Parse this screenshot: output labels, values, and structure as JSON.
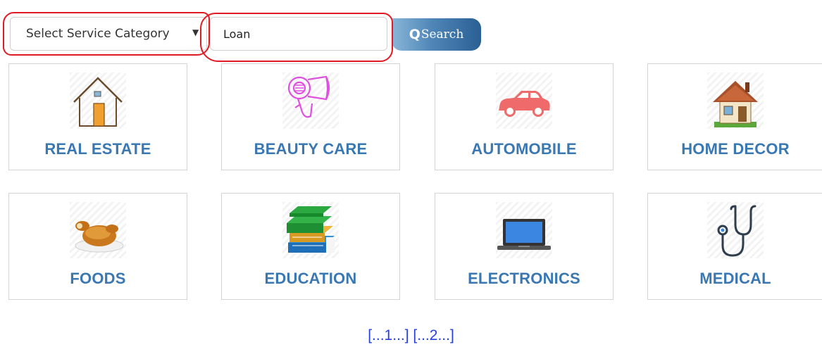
{
  "search": {
    "category_select": {
      "value": "Select Service Category"
    },
    "query_input": {
      "value": "Loan"
    },
    "button_label": "Search"
  },
  "categories": [
    {
      "label": "REAL ESTATE",
      "icon": "house-icon"
    },
    {
      "label": "BEAUTY CARE",
      "icon": "hair-dryer-icon"
    },
    {
      "label": "AUTOMOBILE",
      "icon": "car-icon"
    },
    {
      "label": "HOME DECOR",
      "icon": "home-decor-icon"
    },
    {
      "label": "FOODS",
      "icon": "roast-chicken-icon"
    },
    {
      "label": "EDUCATION",
      "icon": "books-icon"
    },
    {
      "label": "ELECTRONICS",
      "icon": "laptop-icon"
    },
    {
      "label": "MEDICAL",
      "icon": "stethoscope-icon"
    }
  ],
  "pagination": {
    "page1": "[...1...]",
    "page2": "[...2...]"
  },
  "colors": {
    "category_label": "#3a78b3",
    "pager_link": "#2a3fe0",
    "annotation": "#e01b24",
    "button_dark": "#2a5f93"
  }
}
